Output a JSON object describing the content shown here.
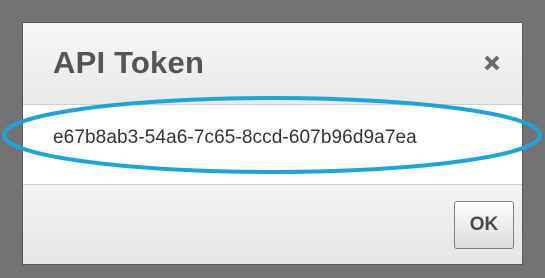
{
  "dialog": {
    "title": "API Token",
    "close_icon": "close-x-icon",
    "token": "e67b8ab3-54a6-7c65-8ccd-607b96d9a7ea",
    "ok_label": "OK"
  },
  "colors": {
    "backdrop": "#737373",
    "title": "#555555",
    "highlight": "#1aa6dd"
  }
}
